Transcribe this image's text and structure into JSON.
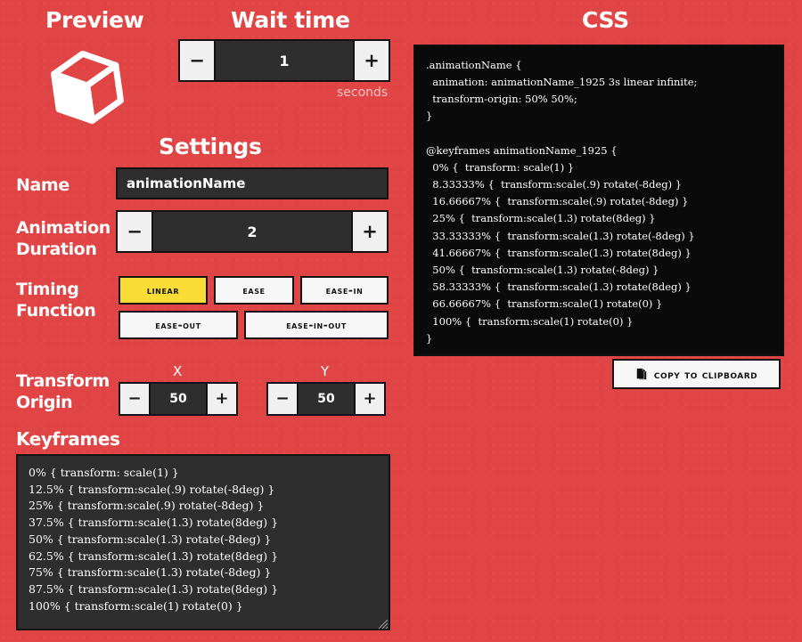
{
  "preview": {
    "title": "Preview",
    "icon": "cube-icon"
  },
  "wait_time": {
    "title": "Wait time",
    "value": "1",
    "unit_label": "seconds",
    "minus_label": "−",
    "plus_label": "+"
  },
  "settings": {
    "title": "Settings",
    "name": {
      "label": "Name",
      "value": "animationName",
      "placeholder": "animationName"
    },
    "duration": {
      "label": "Animation Duration",
      "value": "2",
      "minus_label": "−",
      "plus_label": "+"
    },
    "timing": {
      "label": "Timing Function",
      "active": "LINEAR",
      "options": [
        "LINEAR",
        "EASE",
        "EASE-IN",
        "EASE-OUT",
        "EASE-IN-OUT"
      ]
    },
    "transform_origin": {
      "label": "Transform Origin",
      "x_axis_label": "X",
      "y_axis_label": "Y",
      "x_value": "50",
      "y_value": "50",
      "minus_label": "−",
      "plus_label": "+"
    },
    "keyframes": {
      "label": "Keyframes",
      "value": "0% { transform: scale(1) }\n12.5% { transform:scale(.9) rotate(-8deg) }\n25% { transform:scale(.9) rotate(-8deg) }\n37.5% { transform:scale(1.3) rotate(8deg) }\n50% { transform:scale(1.3) rotate(-8deg) }\n62.5% { transform:scale(1.3) rotate(8deg) }\n75% { transform:scale(1.3) rotate(-8deg) }\n87.5% { transform:scale(1.3) rotate(8deg) }\n100% { transform:scale(1) rotate(0) }"
    }
  },
  "css_panel": {
    "title": "CSS",
    "code": ".animationName {\n  animation: animationName_1925 3s linear infinite;\n  transform-origin: 50% 50%;\n}\n\n@keyframes animationName_1925 {\n  0% {  transform: scale(1) }\n  8.33333% {  transform:scale(.9) rotate(-8deg) }\n  16.66667% {  transform:scale(.9) rotate(-8deg) }\n  25% {  transform:scale(1.3) rotate(8deg) }\n  33.33333% {  transform:scale(1.3) rotate(-8deg) }\n  41.66667% {  transform:scale(1.3) rotate(8deg) }\n  50% {  transform:scale(1.3) rotate(-8deg) }\n  58.33333% {  transform:scale(1.3) rotate(8deg) }\n  66.66667% {  transform:scale(1) rotate(0) }\n  100% {  transform:scale(1) rotate(0) }\n}",
    "copy_button_label": "COPY TO CLIPBOARD"
  },
  "colors": {
    "background": "#e04444",
    "panel_dark": "#2e2e2e",
    "code_panel": "#0a0a0a",
    "accent_yellow": "#f9dc34",
    "button_light": "#f7f7f7",
    "border_dark": "#131313"
  }
}
